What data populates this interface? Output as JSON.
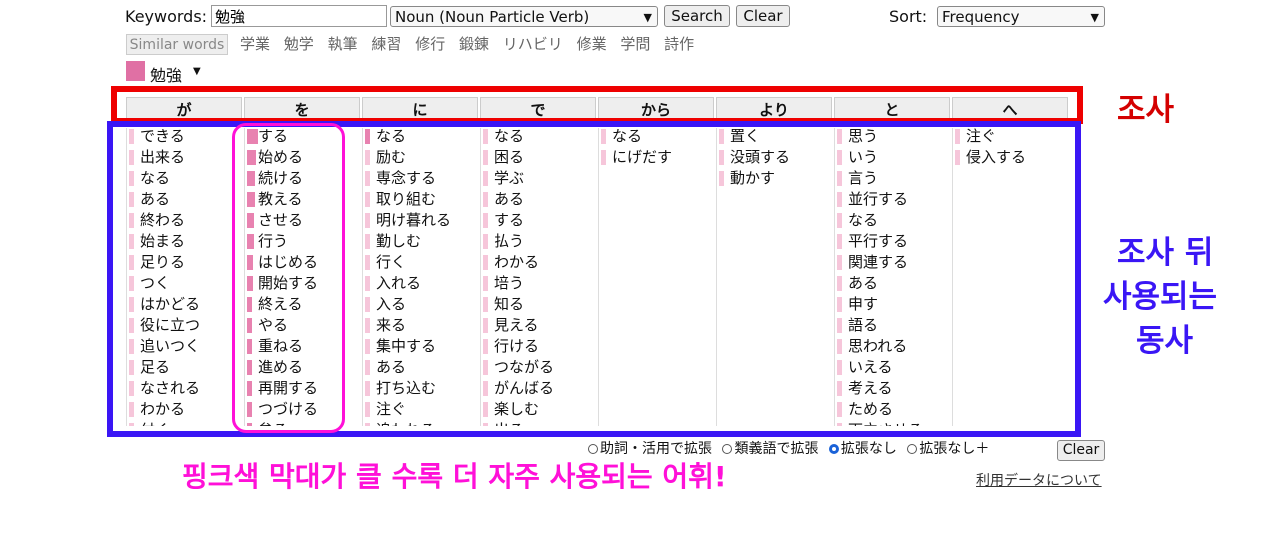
{
  "search": {
    "keywords_label": "Keywords:",
    "keyword_value": "勉強",
    "pos_select": "Noun (Noun Particle Verb)",
    "search_label": "Search",
    "clear_label": "Clear",
    "sort_label": "Sort:",
    "sort_select": "Frequency"
  },
  "similar": {
    "button_label": "Similar words",
    "words": [
      "学業",
      "勉学",
      "執筆",
      "練習",
      "修行",
      "鍛錬",
      "リハビリ",
      "修業",
      "学問",
      "詩作"
    ]
  },
  "selected_word": "勉強",
  "particles": [
    "が",
    "を",
    "に",
    "で",
    "から",
    "より",
    "と",
    "へ"
  ],
  "columns": [
    {
      "items": [
        "できる",
        "出来る",
        "なる",
        "ある",
        "終わる",
        "始まる",
        "足りる",
        "つく",
        "はかどる",
        "役に立つ",
        "追いつく",
        "足る",
        "なされる",
        "わかる",
        "付く"
      ],
      "levels": [
        0.12,
        0.08,
        0.08,
        0.07,
        0.07,
        0.06,
        0.06,
        0.05,
        0.05,
        0.05,
        0.05,
        0.05,
        0.04,
        0.04,
        0.04
      ]
    },
    {
      "items": [
        "する",
        "始める",
        "続ける",
        "教える",
        "させる",
        "行う",
        "はじめる",
        "開始する",
        "終える",
        "やる",
        "重ねる",
        "進める",
        "再開する",
        "つづける",
        "怠る"
      ],
      "levels": [
        0.9,
        0.75,
        0.7,
        0.65,
        0.6,
        0.55,
        0.5,
        0.5,
        0.45,
        0.45,
        0.4,
        0.4,
        0.35,
        0.35,
        0.3
      ]
    },
    {
      "items": [
        "なる",
        "励む",
        "専念する",
        "取り組む",
        "明け暮れる",
        "勤しむ",
        "行く",
        "入れる",
        "入る",
        "来る",
        "集中する",
        "ある",
        "打ち込む",
        "注ぐ",
        "追われる"
      ],
      "levels": [
        0.3,
        0.2,
        0.15,
        0.12,
        0.1,
        0.1,
        0.08,
        0.08,
        0.07,
        0.07,
        0.06,
        0.06,
        0.05,
        0.05,
        0.05
      ]
    },
    {
      "items": [
        "なる",
        "困る",
        "学ぶ",
        "ある",
        "する",
        "払う",
        "わかる",
        "培う",
        "知る",
        "見える",
        "行ける",
        "つながる",
        "がんばる",
        "楽しむ",
        "出る"
      ],
      "levels": [
        0.15,
        0.08,
        0.07,
        0.07,
        0.06,
        0.06,
        0.05,
        0.05,
        0.05,
        0.05,
        0.04,
        0.04,
        0.04,
        0.04,
        0.04
      ]
    },
    {
      "items": [
        "なる",
        "にげだす"
      ],
      "levels": [
        0.06,
        0.04
      ]
    },
    {
      "items": [
        "置く",
        "没頭する",
        "動かす"
      ],
      "levels": [
        0.06,
        0.05,
        0.04
      ]
    },
    {
      "items": [
        "思う",
        "いう",
        "言う",
        "並行する",
        "なる",
        "平行する",
        "関連する",
        "ある",
        "申す",
        "語る",
        "思われる",
        "いえる",
        "考える",
        "ためる",
        "両立させる"
      ],
      "levels": [
        0.12,
        0.08,
        0.07,
        0.06,
        0.06,
        0.05,
        0.05,
        0.05,
        0.04,
        0.04,
        0.04,
        0.04,
        0.04,
        0.04,
        0.04
      ]
    },
    {
      "items": [
        "注ぐ",
        "侵入する"
      ],
      "levels": [
        0.06,
        0.04
      ]
    }
  ],
  "options": {
    "radios": [
      "助詞・活用で拡張",
      "類義語で拡張",
      "拡張なし",
      "拡張なし＋"
    ],
    "selected": "拡張なし",
    "clear_label": "Clear",
    "link": "利用データについて"
  },
  "annotations": {
    "particle_label": "조사",
    "verbs_label_line1": "조사 뒤",
    "verbs_label_line2": "사용되는",
    "verbs_label_line3": "동사",
    "caption": "핑크색 막대가 클 수록 더 자주 사용되는 어휘!",
    "colors": {
      "red": "#e00000",
      "blue": "#3a16f5",
      "magenta": "#ff10d8",
      "bar": "#e882b0"
    }
  }
}
